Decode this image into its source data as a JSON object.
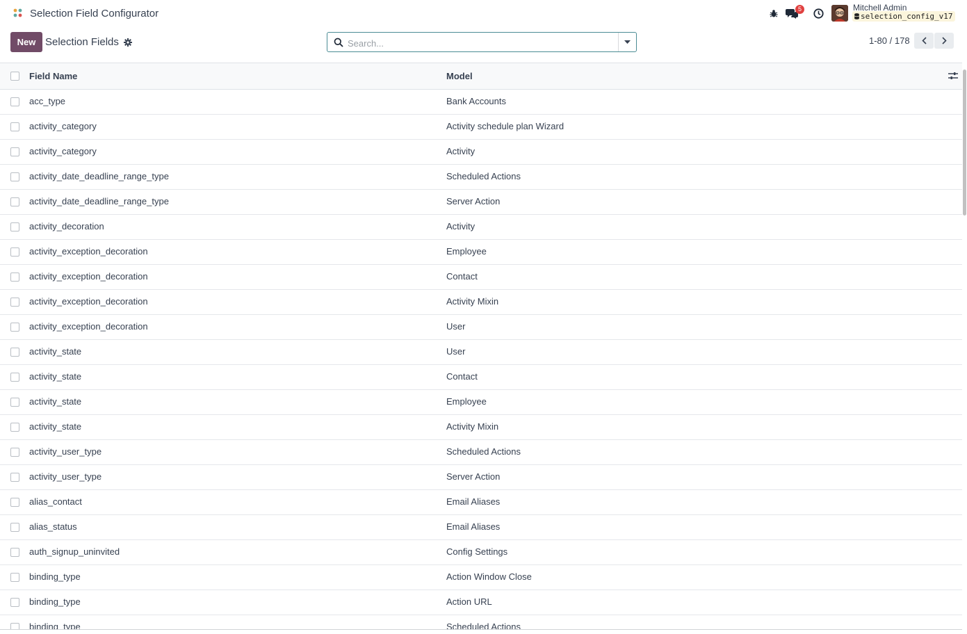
{
  "navbar": {
    "app_title": "Selection Field Configurator",
    "messages_badge": "5",
    "user_name": "Mitchell Admin",
    "database": "selection_config_v17",
    "icons": [
      "bug-icon",
      "chat-icon",
      "clock-icon"
    ]
  },
  "control_panel": {
    "new_label": "New",
    "title": "Selection Fields",
    "search_placeholder": "Search...",
    "pager_value": "1-80 / 178"
  },
  "list": {
    "columns": {
      "name": "Field Name",
      "model": "Model"
    },
    "rows": [
      {
        "name": "acc_type",
        "model": "Bank Accounts"
      },
      {
        "name": "activity_category",
        "model": "Activity schedule plan Wizard"
      },
      {
        "name": "activity_category",
        "model": "Activity"
      },
      {
        "name": "activity_date_deadline_range_type",
        "model": "Scheduled Actions"
      },
      {
        "name": "activity_date_deadline_range_type",
        "model": "Server Action"
      },
      {
        "name": "activity_decoration",
        "model": "Activity"
      },
      {
        "name": "activity_exception_decoration",
        "model": "Employee"
      },
      {
        "name": "activity_exception_decoration",
        "model": "Contact"
      },
      {
        "name": "activity_exception_decoration",
        "model": "Activity Mixin"
      },
      {
        "name": "activity_exception_decoration",
        "model": "User"
      },
      {
        "name": "activity_state",
        "model": "User"
      },
      {
        "name": "activity_state",
        "model": "Contact"
      },
      {
        "name": "activity_state",
        "model": "Employee"
      },
      {
        "name": "activity_state",
        "model": "Activity Mixin"
      },
      {
        "name": "activity_user_type",
        "model": "Scheduled Actions"
      },
      {
        "name": "activity_user_type",
        "model": "Server Action"
      },
      {
        "name": "alias_contact",
        "model": "Email Aliases"
      },
      {
        "name": "alias_status",
        "model": "Email Aliases"
      },
      {
        "name": "auth_signup_uninvited",
        "model": "Config Settings"
      },
      {
        "name": "binding_type",
        "model": "Action Window Close"
      },
      {
        "name": "binding_type",
        "model": "Action URL"
      },
      {
        "name": "binding_type",
        "model": "Scheduled Actions"
      }
    ]
  },
  "colors": {
    "primary": "#714b67",
    "badge": "#e0403f",
    "search_border": "#4b8c94",
    "header_bg": "#f8f9fa"
  }
}
